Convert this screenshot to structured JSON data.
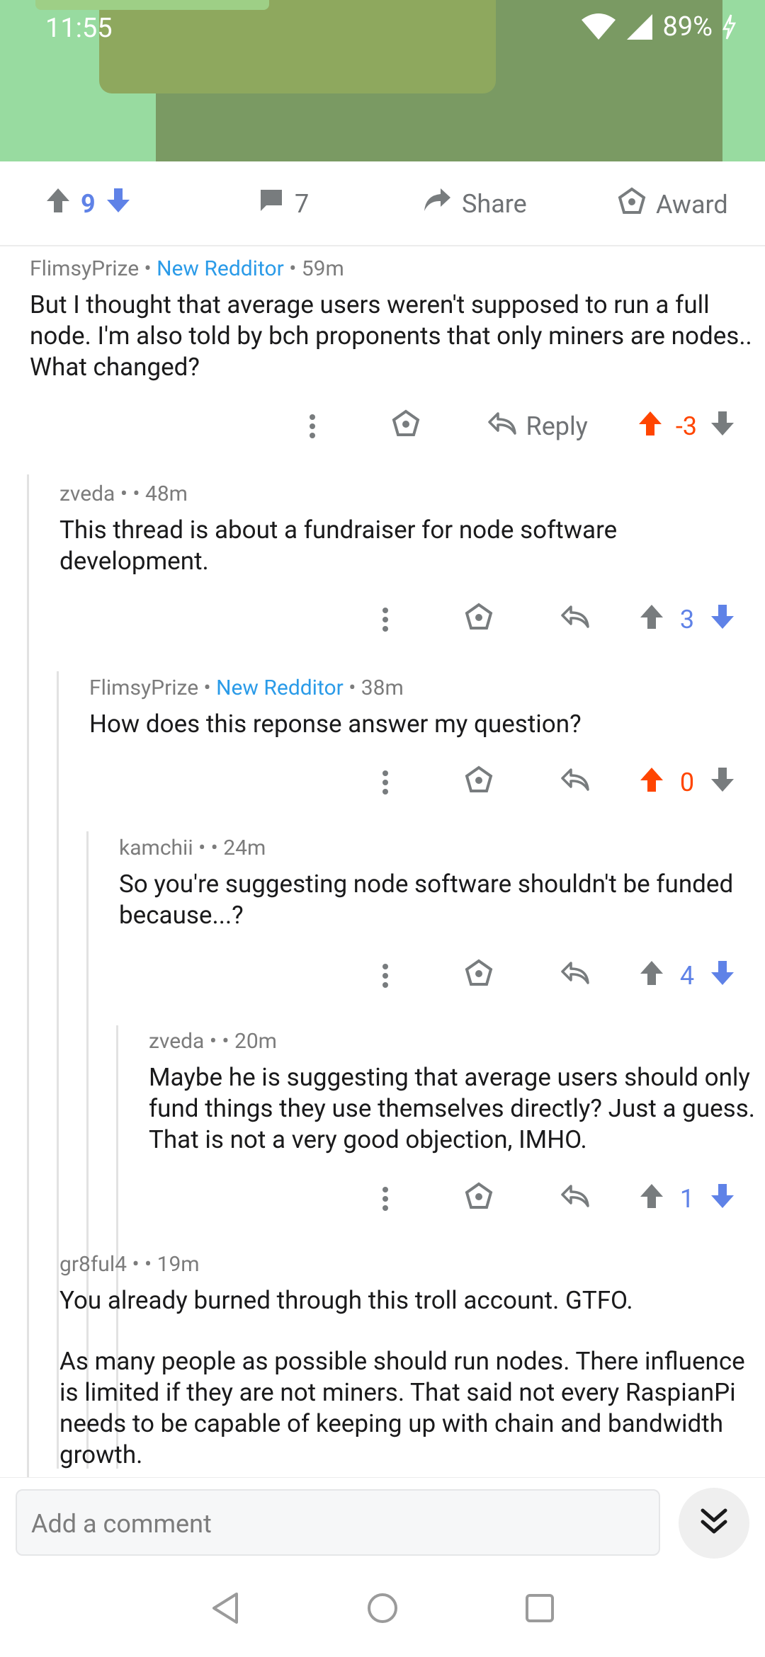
{
  "status_bar": {
    "time": "11:55",
    "battery": "89%"
  },
  "post_actions": {
    "score": "9",
    "comment_count": "7",
    "share_label": "Share",
    "award_label": "Award"
  },
  "comments": [
    {
      "author": "FlimsyPrize",
      "flair": "New Redditor",
      "time": "59m",
      "body": "But I thought that average users weren't supposed to run a full node.  I'm also told by bch proponents that only miners are nodes..  What changed?",
      "reply_label": "Reply",
      "score": "-3"
    },
    {
      "author": "zveda",
      "time": "48m",
      "body": "This thread is about a fundraiser for node software development.",
      "score": "3"
    },
    {
      "author": "FlimsyPrize",
      "flair": "New Redditor",
      "time": "38m",
      "body": "How does this reponse answer my question?",
      "score": "0"
    },
    {
      "author": "kamchii",
      "time": "24m",
      "body": "So you're suggesting node software shouldn't be funded because...?",
      "score": "4"
    },
    {
      "author": "zveda",
      "time": "20m",
      "body": "Maybe he is suggesting that average users should only fund things they use themselves directly? Just a guess. That is not a very good objection, IMHO.",
      "score": "1"
    },
    {
      "author": "gr8ful4",
      "time": "19m",
      "body": "You already burned through this troll account. GTFO.",
      "body2": "As many people as possible should run nodes. There influence is limited if they are not miners. That said not every RaspianPi needs to be capable of keeping up with chain and bandwidth growth."
    }
  ],
  "composer": {
    "placeholder": "Add a comment"
  },
  "colors": {
    "upvote": "#ff4500",
    "downvote": "#5f82e7",
    "flair": "#2b9be8"
  }
}
